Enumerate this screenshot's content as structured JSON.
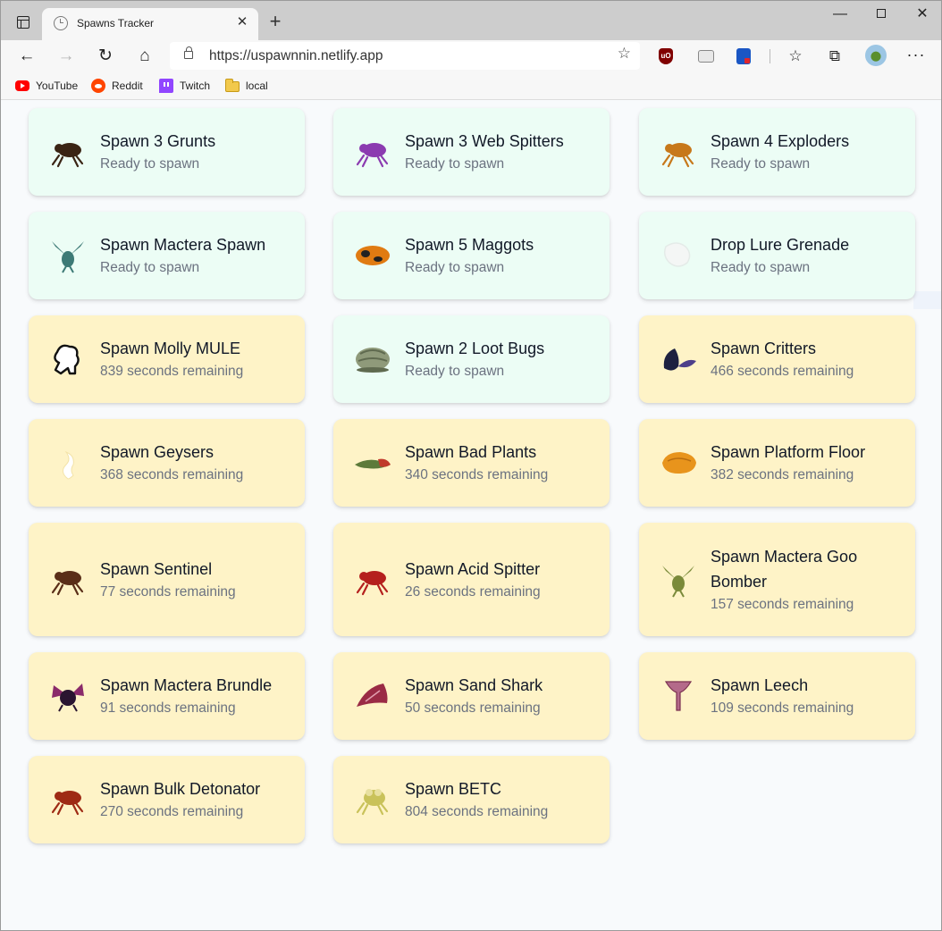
{
  "browser": {
    "tab_title": "Spawns Tracker",
    "tab_close": "✕",
    "new_tab": "+",
    "url": "https://uspawnnin.netlify.app",
    "controls": {
      "minimize": "—",
      "close": "✕"
    },
    "nav": {
      "back": "←",
      "forward": "→",
      "refresh": "↻",
      "home": "⌂"
    },
    "toolbar_icons": {
      "favorites": "☆",
      "collections": "⧉",
      "menu": "···",
      "add_favorite": "☆"
    },
    "extensions": {
      "ublock": "uO"
    },
    "bookmarks": [
      {
        "label": "YouTube",
        "icon": "youtube-icon"
      },
      {
        "label": "Reddit",
        "icon": "reddit-icon"
      },
      {
        "label": "Twitch",
        "icon": "twitch-icon"
      },
      {
        "label": "local",
        "icon": "folder-icon"
      }
    ]
  },
  "colors": {
    "ready_bg": "#ecfdf5",
    "cooldown_bg": "#fef3c7",
    "title_text": "#111827",
    "status_text": "#6b7280"
  },
  "spawns": [
    {
      "title": "Spawn 3 Grunts",
      "status": "Ready to spawn",
      "state": "ready",
      "icon": "grunt-icon",
      "icon_color": "#3a2414"
    },
    {
      "title": "Spawn 3 Web Spitters",
      "status": "Ready to spawn",
      "state": "ready",
      "icon": "web-spitter-icon",
      "icon_color": "#8b3bb0"
    },
    {
      "title": "Spawn 4 Exploders",
      "status": "Ready to spawn",
      "state": "ready",
      "icon": "exploder-icon",
      "icon_color": "#c7781a"
    },
    {
      "title": "Spawn Mactera Spawn",
      "status": "Ready to spawn",
      "state": "ready",
      "icon": "mactera-spawn-icon",
      "icon_color": "#3d7a76"
    },
    {
      "title": "Spawn 5 Maggots",
      "status": "Ready to spawn",
      "state": "ready",
      "icon": "maggot-icon",
      "icon_color": "#e07b12"
    },
    {
      "title": "Drop Lure Grenade",
      "status": "Ready to spawn",
      "state": "ready",
      "icon": "lure-grenade-icon",
      "icon_color": "#f4f6f5"
    },
    {
      "title": "Spawn Molly MULE",
      "status": "839 seconds remaining",
      "state": "cooldown",
      "icon": "molly-mule-icon",
      "icon_color": "#ffffff"
    },
    {
      "title": "Spawn 2 Loot Bugs",
      "status": "Ready to spawn",
      "state": "ready",
      "icon": "loot-bug-icon",
      "icon_color": "#8f9a7a"
    },
    {
      "title": "Spawn Critters",
      "status": "466 seconds remaining",
      "state": "cooldown",
      "icon": "critter-icon",
      "icon_color": "#1e2140"
    },
    {
      "title": "Spawn Geysers",
      "status": "368 seconds remaining",
      "state": "cooldown",
      "icon": "geyser-icon",
      "icon_color": "#ffffff"
    },
    {
      "title": "Spawn Bad Plants",
      "status": "340 seconds remaining",
      "state": "cooldown",
      "icon": "bad-plant-icon",
      "icon_color": "#5d7a3a"
    },
    {
      "title": "Spawn Platform Floor",
      "status": "382 seconds remaining",
      "state": "cooldown",
      "icon": "platform-icon",
      "icon_color": "#e8941c"
    },
    {
      "title": "Spawn Sentinel",
      "status": "77 seconds remaining",
      "state": "cooldown",
      "icon": "sentinel-icon",
      "icon_color": "#5a2e18"
    },
    {
      "title": "Spawn Acid Spitter",
      "status": "26 seconds remaining",
      "state": "cooldown",
      "icon": "acid-spitter-icon",
      "icon_color": "#b5201e"
    },
    {
      "title": "Spawn Mactera Goo Bomber",
      "status": "157 seconds remaining",
      "state": "cooldown",
      "icon": "goo-bomber-icon",
      "icon_color": "#7a8a3a"
    },
    {
      "title": "Spawn Mactera Brundle",
      "status": "91 seconds remaining",
      "state": "cooldown",
      "icon": "brundle-icon",
      "icon_color": "#2a1530"
    },
    {
      "title": "Spawn Sand Shark",
      "status": "50 seconds remaining",
      "state": "cooldown",
      "icon": "sand-shark-icon",
      "icon_color": "#9a2b45"
    },
    {
      "title": "Spawn Leech",
      "status": "109 seconds remaining",
      "state": "cooldown",
      "icon": "leech-icon",
      "icon_color": "#b46a8a"
    },
    {
      "title": "Spawn Bulk Detonator",
      "status": "270 seconds remaining",
      "state": "cooldown",
      "icon": "bulk-detonator-icon",
      "icon_color": "#9e2a14"
    },
    {
      "title": "Spawn BETC",
      "status": "804 seconds remaining",
      "state": "cooldown",
      "icon": "betc-icon",
      "icon_color": "#c9c25a"
    }
  ]
}
